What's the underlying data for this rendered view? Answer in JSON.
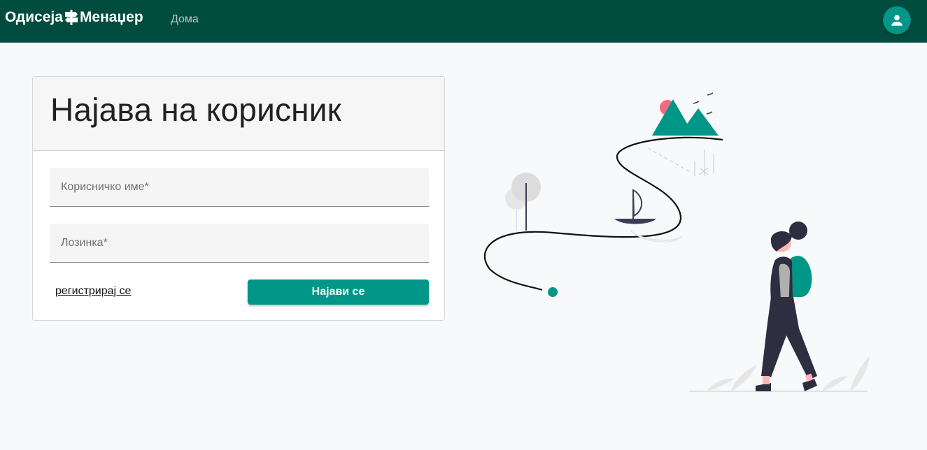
{
  "navbar": {
    "brand_part1": "Одисеја",
    "brand_icon": "signpost-icon",
    "brand_part2": "Менаџер",
    "home_link": "Дома",
    "avatar_icon": "person-icon",
    "background_color": "#004d40"
  },
  "login": {
    "title": "Најава на корисник",
    "username_label": "Корисничко име*",
    "password_label": "Лозинка*",
    "register_link": "регистрирај се",
    "submit_label": "Најави се",
    "accent_color": "#009688"
  },
  "illustration": {
    "name": "traveler-with-map-path-illustration",
    "icons": [
      "mountain-icon",
      "sun-icon",
      "bird-icon",
      "tree-icon",
      "boat-icon",
      "hiker-icon",
      "plant-icon"
    ]
  }
}
